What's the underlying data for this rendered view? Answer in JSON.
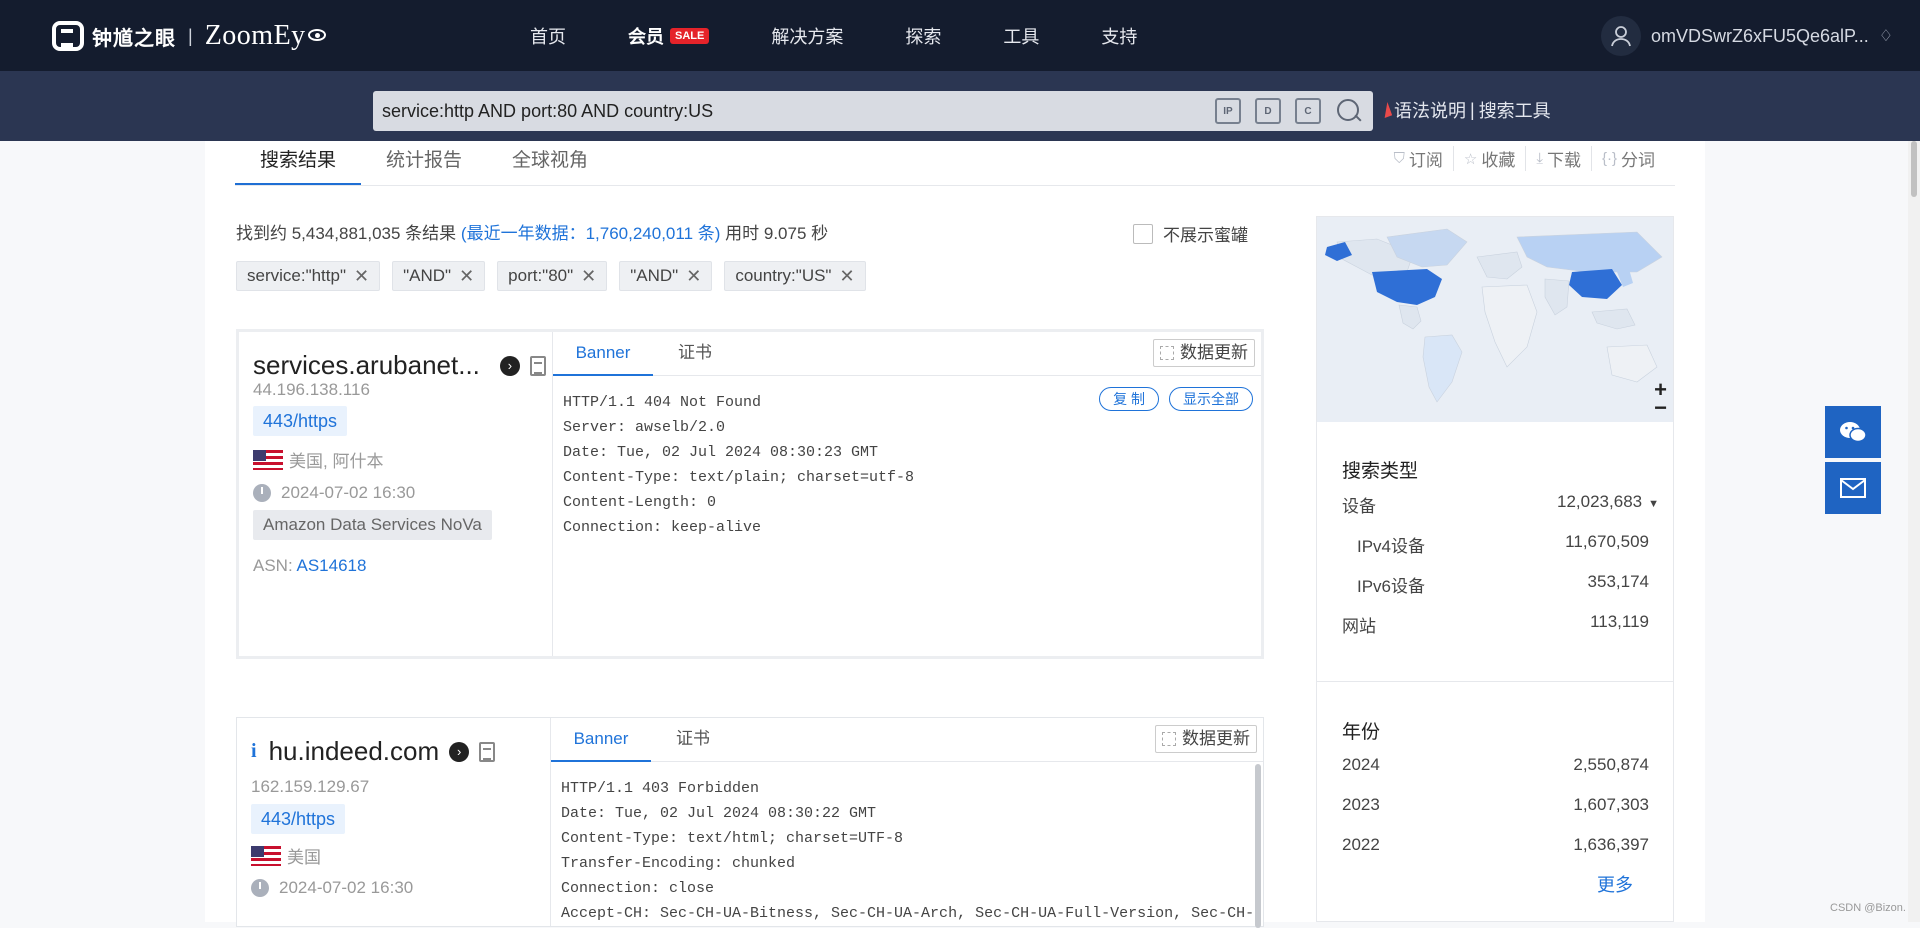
{
  "header": {
    "logo_cn": "钟馗之眼",
    "logo_sep": "|",
    "logo_en": "ZoomEy",
    "nav": [
      {
        "label": "首页"
      },
      {
        "label": "会员",
        "badge": "SALE"
      },
      {
        "label": "解决方案"
      },
      {
        "label": "探索"
      },
      {
        "label": "工具"
      },
      {
        "label": "支持"
      }
    ],
    "username": "omVDSwrZ6xFU5Qe6alP..."
  },
  "search": {
    "query": "service:http AND port:80 AND country:US",
    "icons": [
      "IP",
      "D",
      "C"
    ],
    "syntax_link": "语法说明",
    "tools_link": "搜索工具",
    "sep": "|"
  },
  "tabs": [
    "搜索结果",
    "统计报告",
    "全球视角"
  ],
  "actions": [
    {
      "icon": "bookmark-icon",
      "label": "订阅"
    },
    {
      "icon": "star-icon",
      "label": "收藏"
    },
    {
      "icon": "download-icon",
      "label": "下载"
    },
    {
      "icon": "bracket-icon",
      "label": "分词"
    }
  ],
  "summary": {
    "prefix": "找到约 5,434,881,035 条结果",
    "year_data": "(最近一年数据：1,760,240,011 条)",
    "time": "用时 9.075 秒"
  },
  "honeypot_label": "不展示蜜罐",
  "chips": [
    "service:\"http\"",
    "\"AND\"",
    "port:\"80\"",
    "\"AND\"",
    "country:\"US\""
  ],
  "chip_close": "✕",
  "results": [
    {
      "host": "services.arubanet...",
      "ip": "44.196.138.116",
      "port": "443/https",
      "location": "美国, 阿什本",
      "time": "2024-07-02 16:30",
      "org": "Amazon Data Services NoVa",
      "asn_label": "ASN:",
      "asn": "AS14618",
      "tab_banner": "Banner",
      "tab_cert": "证书",
      "update": "数据更新",
      "copy": "复 制",
      "show_all": "显示全部",
      "banner": "HTTP/1.1 404 Not Found\nServer: awselb/2.0\nDate: Tue, 02 Jul 2024 08:30:23 GMT\nContent-Type: text/plain; charset=utf-8\nContent-Length: 0\nConnection: keep-alive"
    },
    {
      "info_icon": "i",
      "host": "hu.indeed.com",
      "ip": "162.159.129.67",
      "port": "443/https",
      "location": "美国",
      "time": "2024-07-02 16:30",
      "tab_banner": "Banner",
      "tab_cert": "证书",
      "update": "数据更新",
      "banner": "HTTP/1.1 403 Forbidden\nDate: Tue, 02 Jul 2024 08:30:22 GMT\nContent-Type: text/html; charset=UTF-8\nTransfer-Encoding: chunked\nConnection: close\nAccept-CH: Sec-CH-UA-Bitness, Sec-CH-UA-Arch, Sec-CH-UA-Full-Version, Sec-CH-"
    }
  ],
  "map": {
    "zoom_in": "+",
    "zoom_out": "−",
    "highlight": "#2f6fd6",
    "light": "#b8d1f3"
  },
  "stats": {
    "type_title": "搜索类型",
    "types": [
      {
        "label": "设备",
        "value": "12,023,683",
        "caret": "▼"
      },
      {
        "label": "IPv4设备",
        "value": "11,670,509"
      },
      {
        "label": "IPv6设备",
        "value": "353,174"
      },
      {
        "label": "网站",
        "value": "113,119"
      }
    ],
    "year_title": "年份",
    "years": [
      {
        "label": "2024",
        "value": "2,550,874"
      },
      {
        "label": "2023",
        "value": "1,607,303"
      },
      {
        "label": "2022",
        "value": "1,636,397"
      }
    ],
    "more": "更多"
  },
  "watermark": "CSDN @Bizon.",
  "colors": {
    "topbar": "#141c2e",
    "searchbar": "#2b3652",
    "accent": "#1f73d9",
    "sale": "#e5232a"
  }
}
